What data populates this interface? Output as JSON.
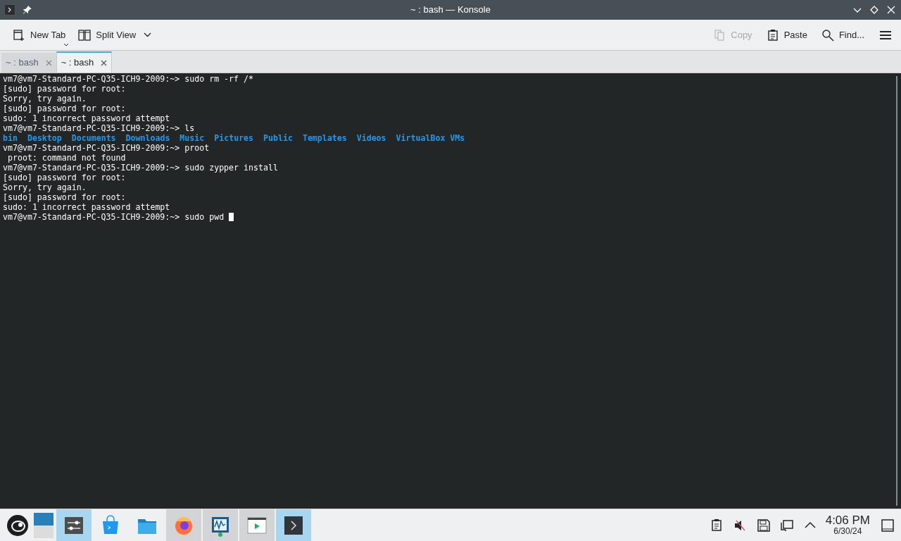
{
  "window": {
    "title": "~ : bash — Konsole"
  },
  "toolbar": {
    "left": [
      {
        "label": "New Tab",
        "kind": "newtab",
        "disabled": false
      },
      {
        "label": "Split View",
        "kind": "split",
        "disabled": false
      }
    ],
    "right": [
      {
        "label": "Copy",
        "kind": "copy",
        "disabled": true
      },
      {
        "label": "Paste",
        "kind": "paste",
        "disabled": false
      },
      {
        "label": "Find...",
        "kind": "find",
        "disabled": false
      }
    ]
  },
  "tabs": [
    {
      "label": "~ : bash",
      "selected": false
    },
    {
      "label": "~ : bash",
      "selected": true
    }
  ],
  "terminal": {
    "lines": [
      {
        "kind": "prompt",
        "prompt": "vm7@vm7-Standard-PC-Q35-ICH9-2009:~>",
        "command": "sudo rm -rf /*"
      },
      {
        "kind": "output",
        "text": "[sudo] password for root:"
      },
      {
        "kind": "output",
        "text": "Sorry, try again."
      },
      {
        "kind": "output",
        "text": "[sudo] password for root:"
      },
      {
        "kind": "output",
        "text": "sudo: 1 incorrect password attempt"
      },
      {
        "kind": "prompt",
        "prompt": "vm7@vm7-Standard-PC-Q35-ICH9-2009:~>",
        "command": "ls"
      },
      {
        "kind": "listing",
        "items": [
          "bin",
          "Desktop",
          "Documents",
          "Downloads",
          "Music",
          "Pictures",
          "Public",
          "Templates",
          "Videos",
          "VirtualBox VMs"
        ]
      },
      {
        "kind": "prompt",
        "prompt": "vm7@vm7-Standard-PC-Q35-ICH9-2009:~>",
        "command": "proot"
      },
      {
        "kind": "output",
        "text": " proot: command not found"
      },
      {
        "kind": "prompt",
        "prompt": "vm7@vm7-Standard-PC-Q35-ICH9-2009:~>",
        "command": "sudo zypper install"
      },
      {
        "kind": "output",
        "text": "[sudo] password for root:"
      },
      {
        "kind": "output",
        "text": "Sorry, try again."
      },
      {
        "kind": "output",
        "text": "[sudo] password for root:"
      },
      {
        "kind": "output",
        "text": "sudo: 1 incorrect password attempt"
      },
      {
        "kind": "prompt",
        "prompt": "vm7@vm7-Standard-PC-Q35-ICH9-2009:~>",
        "command": "sudo pwd",
        "cursor": true
      }
    ]
  },
  "taskbar": {
    "apps": [
      {
        "kind": "settings",
        "active": true
      },
      {
        "kind": "store",
        "active": false,
        "open": false
      },
      {
        "kind": "files",
        "active": false,
        "open": false
      },
      {
        "kind": "browser",
        "active": false,
        "open": true
      },
      {
        "kind": "monitor",
        "active": false,
        "open": true
      },
      {
        "kind": "player",
        "active": false,
        "open": true
      },
      {
        "kind": "terminal",
        "active": true
      }
    ],
    "tray": [
      {
        "kind": "clipboard"
      },
      {
        "kind": "muted"
      },
      {
        "kind": "disk"
      },
      {
        "kind": "network"
      },
      {
        "kind": "expand"
      }
    ],
    "time": "4:06 PM",
    "date": "6/30/24"
  }
}
